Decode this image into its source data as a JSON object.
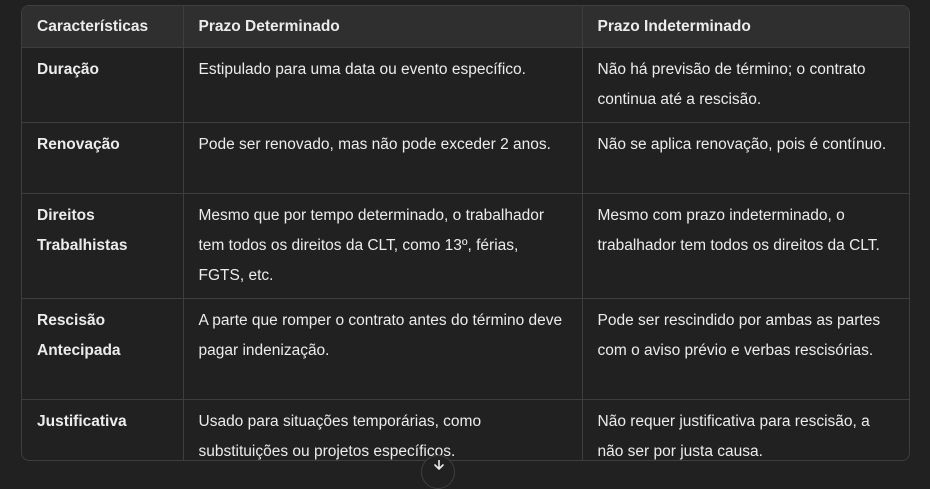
{
  "table": {
    "headers": [
      "Características",
      "Prazo Determinado",
      "Prazo Indeterminado"
    ],
    "rows": [
      {
        "label": "Duração",
        "determinado": "Estipulado para uma data ou evento específico.",
        "indeterminado": "Não há previsão de término; o contrato continua até a rescisão."
      },
      {
        "label": "Renovação",
        "determinado": "Pode ser renovado, mas não pode exceder 2 anos.",
        "indeterminado": "Não se aplica renovação, pois é contínuo."
      },
      {
        "label": "Direitos Trabalhistas",
        "determinado": "Mesmo que por tempo determinado, o trabalhador tem todos os direitos da CLT, como 13º, férias, FGTS, etc.",
        "indeterminado": "Mesmo com prazo indeterminado, o trabalhador tem todos os direitos da CLT."
      },
      {
        "label": "Rescisão Antecipada",
        "determinado": "A parte que romper o contrato antes do término deve pagar indenização.",
        "indeterminado": "Pode ser rescindido por ambas as partes com o aviso prévio e verbas rescisórias."
      },
      {
        "label": "Justificativa",
        "determinado": "Usado para situações temporárias, como substituições ou projetos específicos.",
        "indeterminado": "Não requer justificativa para rescisão, a não ser por justa causa."
      }
    ]
  },
  "scroll_button": {
    "icon": "arrow-down-icon"
  }
}
